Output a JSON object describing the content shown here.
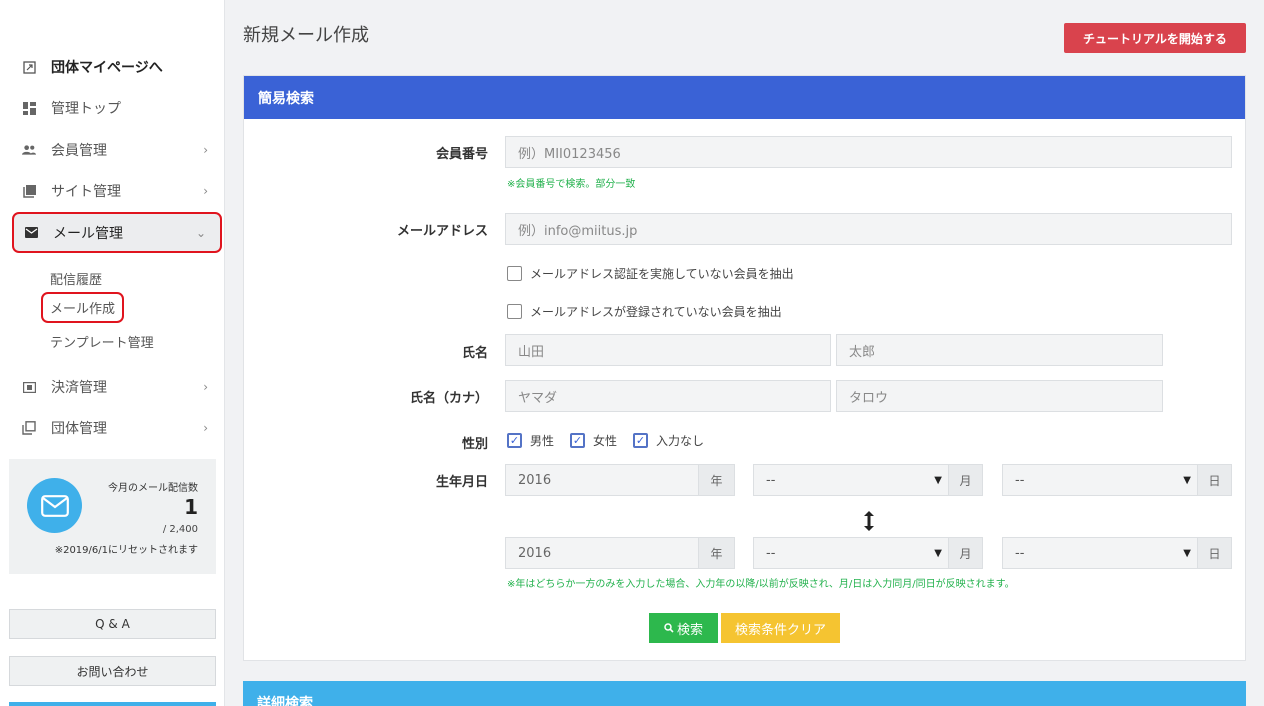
{
  "sidebar": {
    "items": [
      {
        "label": "団体マイページへ",
        "icon": "external-link-icon"
      },
      {
        "label": "管理トップ",
        "icon": "dashboard-icon"
      },
      {
        "label": "会員管理",
        "icon": "people-icon"
      },
      {
        "label": "サイト管理",
        "icon": "images-icon"
      },
      {
        "label": "メール管理",
        "icon": "mail-icon"
      },
      {
        "label": "決済管理",
        "icon": "payment-icon"
      },
      {
        "label": "団体管理",
        "icon": "copy-icon"
      }
    ],
    "mail_sub": [
      "配信履歴",
      "メール作成",
      "テンプレート管理"
    ],
    "mail_stats": {
      "title": "今月のメール配信数",
      "count": "1",
      "limit": "/ 2,400",
      "reset_note": "※2019/6/1にリセットされます"
    },
    "qa_label": "Q & A",
    "contact_label": "お問い合わせ"
  },
  "header": {
    "title": "新規メール作成",
    "tutorial_label": "チュートリアルを開始する"
  },
  "simple_search": {
    "title": "簡易検索",
    "member_no": {
      "label": "会員番号",
      "placeholder": "例）MII0123456",
      "hint": "※会員番号で検索。部分一致"
    },
    "email": {
      "label": "メールアドレス",
      "placeholder": "例）info@miitus.jp"
    },
    "email_checks": [
      "メールアドレス認証を実施していない会員を抽出",
      "メールアドレスが登録されていない会員を抽出"
    ],
    "name": {
      "label": "氏名",
      "last_placeholder": "山田",
      "first_placeholder": "太郎"
    },
    "kana": {
      "label": "氏名（カナ）",
      "last_placeholder": "ヤマダ",
      "first_placeholder": "タロウ"
    },
    "gender": {
      "label": "性別",
      "options": [
        "男性",
        "女性",
        "入力なし"
      ]
    },
    "birthday": {
      "label": "生年月日",
      "from": {
        "year": "2016",
        "month": "--",
        "day": "--"
      },
      "to": {
        "year": "2016",
        "month": "--",
        "day": "--"
      },
      "year_suffix": "年",
      "month_suffix": "月",
      "day_suffix": "日",
      "hint": "※年はどちらか一方のみを入力した場合、入力年の以降/以前が反映され、月/日は入力同月/同日が反映されます。"
    },
    "search_label": "検索",
    "clear_label": "検索条件クリア"
  },
  "detail_search": {
    "title": "詳細検索"
  },
  "colors": {
    "primary": "#3a62d6",
    "danger": "#d9434d",
    "success": "#2db84d",
    "warning": "#f5c431",
    "info": "#3fb0ea"
  }
}
